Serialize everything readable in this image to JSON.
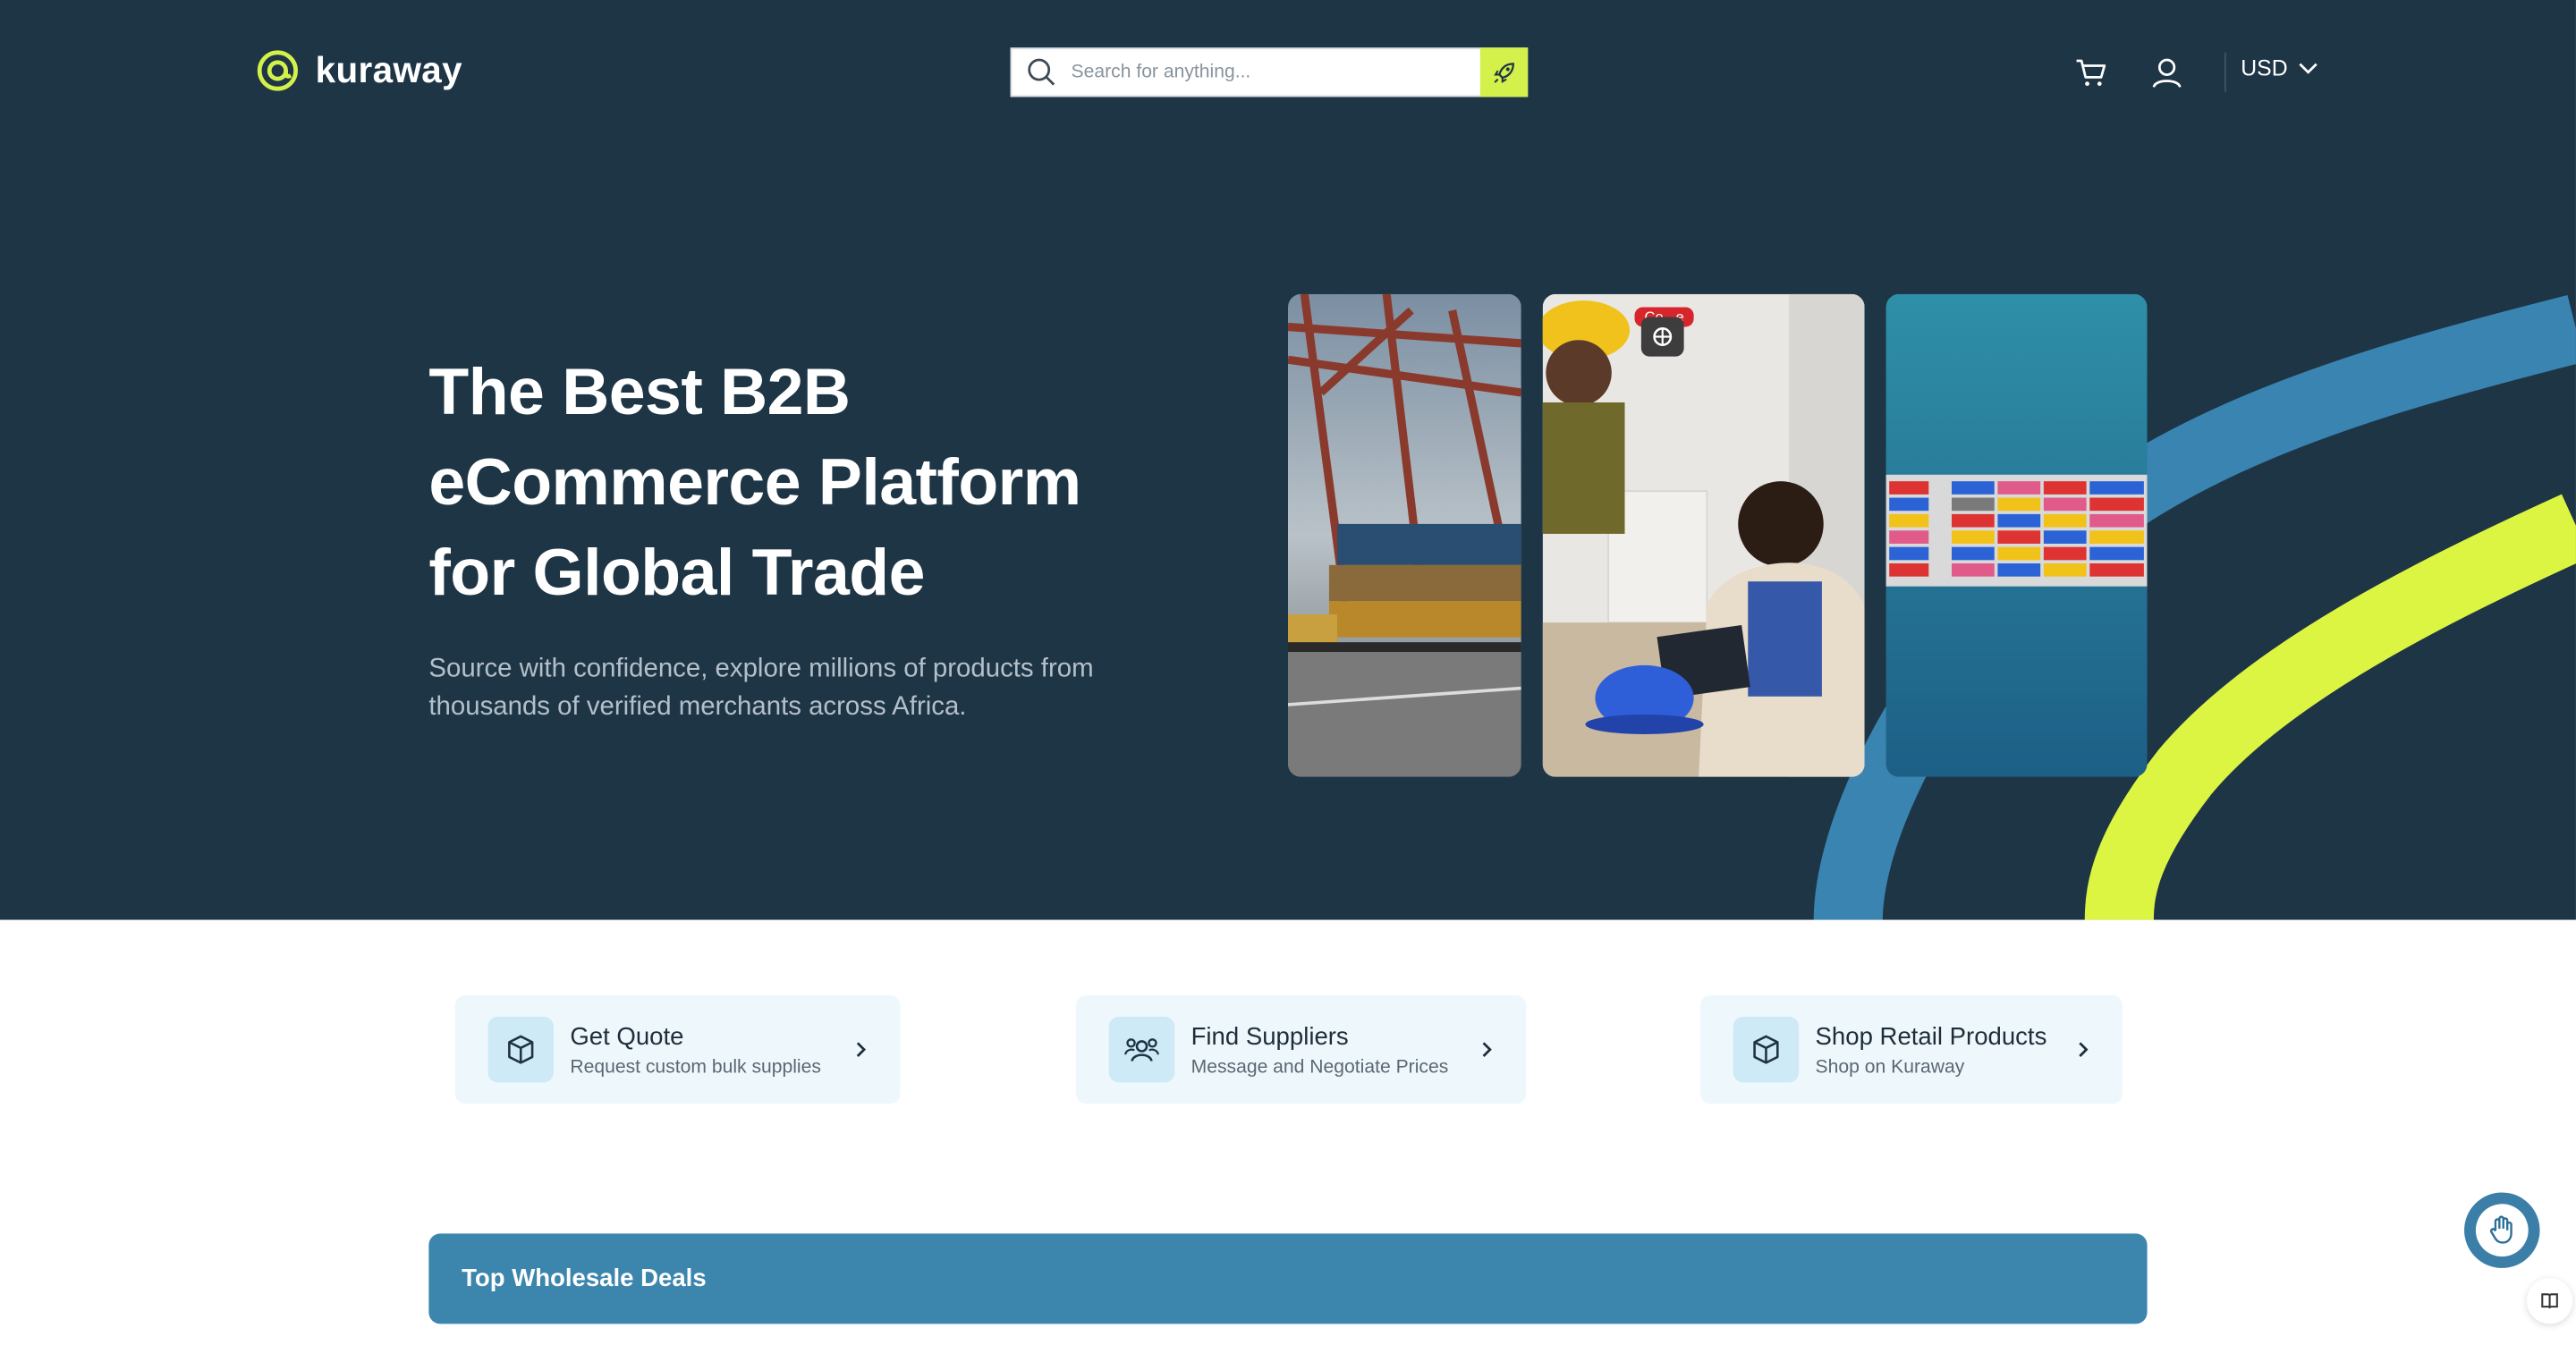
{
  "header": {
    "logo_text": "kuraway",
    "search_placeholder": "Search for anything...",
    "currency": "USD",
    "icons": [
      "logo-icon",
      "search-icon",
      "rocket-icon",
      "cart-icon",
      "user-icon",
      "chevron-down-icon"
    ]
  },
  "hero": {
    "title": "The Best B2B eCommerce Platform for Global Trade",
    "subtitle": "Source with confidence, explore millions of products from thousands of verified merchants across Africa.",
    "photos": [
      "port-containers-photo",
      "warehouse-workers-photo",
      "cargo-ship-aerial-photo"
    ],
    "badge_text": "Ce...e"
  },
  "quick_actions": [
    {
      "title": "Get Quote",
      "subtitle": "Request custom bulk supplies",
      "icon": "box-icon"
    },
    {
      "title": "Find Suppliers",
      "subtitle": "Message and Negotiate Prices",
      "icon": "people-icon"
    },
    {
      "title": "Shop Retail Products",
      "subtitle": "Shop on Kuraway",
      "icon": "box-icon"
    }
  ],
  "deals": {
    "title": "Top Wholesale Deals"
  },
  "colors": {
    "hero_bg": "#1e3546",
    "accent_lime": "#d4f04a",
    "accent_blue": "#3c86ae",
    "card_bg": "#eef8fc"
  }
}
